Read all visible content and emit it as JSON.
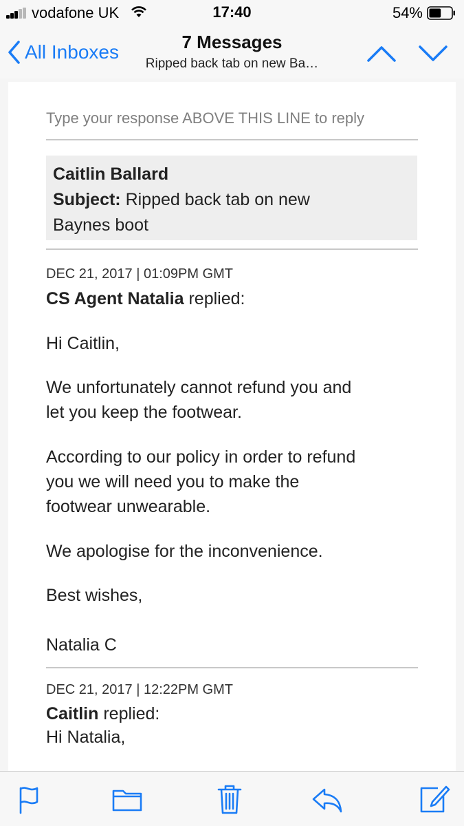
{
  "status_bar": {
    "carrier": "vodafone UK",
    "time": "17:40",
    "battery_percent": "54%",
    "battery_level": 0.54,
    "signal_bars_filled": 3,
    "signal_bars_total": 5
  },
  "nav": {
    "back_label": "All Inboxes",
    "title": "7 Messages",
    "subtitle": "Ripped back tab on new Ba…",
    "accent_color": "#1a7cf6"
  },
  "message": {
    "reply_instruction": "Type your response ABOVE THIS LINE to reply",
    "ticket": {
      "customer_name": "Caitlin Ballard",
      "subject_label": "Subject:",
      "subject_line1": " Ripped back tab on new",
      "subject_line2": "Baynes boot"
    },
    "reply1": {
      "meta": "DEC 21, 2017  |  01:09PM GMT",
      "author": "CS Agent Natalia",
      "action": " replied:",
      "greeting": "Hi Caitlin,",
      "para1_line1": "We unfortunately cannot refund you and",
      "para1_line2": "let you keep the footwear.",
      "para2_line1": "According to our policy in order to refund",
      "para2_line2": "you we will need you to make the",
      "para2_line3": "footwear unwearable.",
      "para3": "We apologise for the inconvenience.",
      "signoff": "Best wishes,",
      "signature": "Natalia C"
    },
    "reply2": {
      "meta": "DEC 21, 2017  |  12:22PM GMT",
      "author": "Caitlin",
      "action": " replied:",
      "greeting": "Hi Natalia,"
    }
  },
  "toolbar": {
    "items": [
      "flag-icon",
      "folder-icon",
      "trash-icon",
      "reply-icon",
      "compose-icon"
    ]
  }
}
